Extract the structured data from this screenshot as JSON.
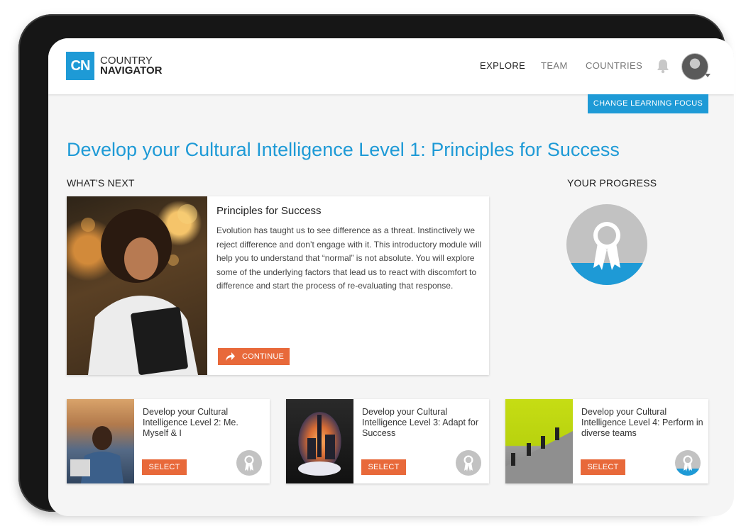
{
  "header": {
    "logo_abbr": "CN",
    "logo_line1": "COUNTRY",
    "logo_line2": "NAVIGATOR",
    "nav": [
      "EXPLORE",
      "TEAM",
      "COUNTRIES"
    ]
  },
  "focus_button_label": "CHANGE LEARNING FOCUS",
  "page_title": "Develop your Cultural Intelligence Level 1: Principles for Success",
  "whats_next_label": "WHAT'S NEXT",
  "progress_label": "YOUR PROGRESS",
  "main_card": {
    "title": "Principles for Success",
    "text": "Evolution has taught us to see difference as a threat. Instinctively we reject difference and don’t engage with it. This introductory module will help you to understand that “normal” is not absolute. You will explore some of the underlying factors that lead us to react with discomfort to difference and start the process of re-evaluating that response.",
    "button_label": "CONTINUE"
  },
  "courses": [
    {
      "title": "Develop your Cultural Intelligence Level 2: Me. Myself & I",
      "button_label": "SELECT"
    },
    {
      "title": "Develop your Cultural Intelligence Level 3: Adapt for Success",
      "button_label": "SELECT"
    },
    {
      "title": "Develop your Cultural Intelligence Level 4: Perform in diverse teams",
      "button_label": "SELECT"
    }
  ],
  "colors": {
    "brand_blue": "#1e9ad6",
    "action_orange": "#e8693a",
    "badge_grey": "#c2c2c2"
  },
  "icons": [
    "bell-icon",
    "share-arrow-icon",
    "award-ribbon-icon"
  ]
}
